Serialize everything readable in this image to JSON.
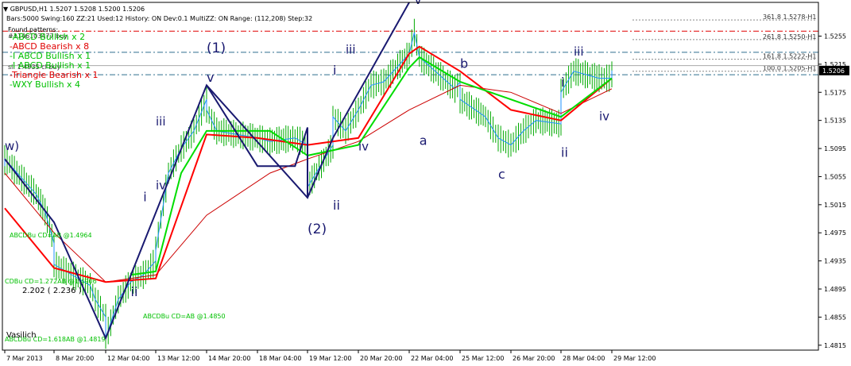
{
  "header": {
    "symbol_line": "GBPUSD,H1  1.5207 1.5208 1.5200 1.5206",
    "info_line": "Bars:5000  Swing:160  ZZ:21  Used:12  History: ON Dev:0.1  MultiZZ: ON  Range: (112,208)  Step:32",
    "found_patterns": "Found patterns:",
    "overlay_1": "#1146103477 buy",
    "overlay_2": "sl: 1.4935 cl buy"
  },
  "patterns": [
    {
      "label": "-ABCD Bullish x 2",
      "color": "#00c000"
    },
    {
      "label": "-ABCD Bearish x 8",
      "color": "#e00000"
    },
    {
      "label": "-I ABCD Bullish x 1",
      "color": "#00c000"
    },
    {
      "label": "-I ABCD Bullish x 1",
      "color": "#00c000"
    },
    {
      "label": "-Triangle Bearish x 1",
      "color": "#e00000"
    },
    {
      "label": "-WXY Bullish x 4",
      "color": "#00c000"
    }
  ],
  "annotations": {
    "abcd_1": "ABCDBu CD=AB   @1.4964",
    "abcd_2": "CDBu CD=1.272AB   @1.4906",
    "abcd_3": "ABCDBu CD=AB   @1.4850",
    "abcd_4": "ABCDBu CD=1.618AB   @1.4819",
    "ratio": "2.202 ( 2.236 )",
    "vasilich": "Vasilich"
  },
  "fib_levels": [
    {
      "label": "361.8 1.5278-H1",
      "price": 1.5278
    },
    {
      "label": "261.8 1.5250-H1",
      "price": 1.525
    },
    {
      "label": "161.8 1.5222-H1",
      "price": 1.5222
    },
    {
      "label": "100.0 1.5205-H1",
      "price": 1.5205
    }
  ],
  "waves": [
    {
      "label": "w)",
      "x": "7 Mar 2013",
      "y": 1.5093,
      "size": 15
    },
    {
      "label": "(1)",
      "x": "14 Mar 20:00",
      "y": 1.5232,
      "size": 17
    },
    {
      "label": "v",
      "x": "14 Mar 20:00",
      "y": 1.519,
      "size": 16
    },
    {
      "label": "iii",
      "x": "13 Mar 12:00",
      "y": 1.5128,
      "size": 15
    },
    {
      "label": "iv",
      "x": "13 Mar 12:00",
      "y": 1.5037,
      "size": 15
    },
    {
      "label": "i",
      "x": "13 Mar 04:00",
      "y": 1.502,
      "size": 16
    },
    {
      "label": "ii",
      "x": "12 Mar 20:00",
      "y": 1.4885,
      "size": 16
    },
    {
      "label": "i",
      "x": "20 Mar 04:00",
      "y": 1.52,
      "size": 16
    },
    {
      "label": "iii",
      "x": "20 Mar 12:00",
      "y": 1.523,
      "size": 15
    },
    {
      "label": "iv",
      "x": "20 Mar 20:00",
      "y": 1.5092,
      "size": 15
    },
    {
      "label": "ii",
      "x": "20 Mar 04:00",
      "y": 1.5008,
      "size": 16
    },
    {
      "label": "(2)",
      "x": "19 Mar 12:00",
      "y": 1.4974,
      "size": 17
    },
    {
      "label": "v",
      "x": "22 Mar 12:00",
      "y": 1.5301,
      "size": 16
    },
    {
      "label": "a",
      "x": "22 Mar 20:00",
      "y": 1.51,
      "size": 16
    },
    {
      "label": "b",
      "x": "25 Mar 12:00",
      "y": 1.521,
      "size": 16
    },
    {
      "label": "c",
      "x": "26 Mar 12:00",
      "y": 1.5052,
      "size": 16
    },
    {
      "label": "i",
      "x": "28 Mar 04:00",
      "y": 1.5183,
      "size": 16
    },
    {
      "label": "ii",
      "x": "28 Mar 04:00",
      "y": 1.5083,
      "size": 16
    },
    {
      "label": "iii",
      "x": "28 Mar 12:00",
      "y": 1.5227,
      "size": 15
    },
    {
      "label": "iv",
      "x": "29 Mar 04:00",
      "y": 1.5135,
      "size": 15
    }
  ],
  "colors": {
    "background": "#ffffff",
    "bars": "#00aa00",
    "ma_fast": "#ff0000",
    "ma_slow_line": "#cc0000",
    "ma_green": "#00dd00",
    "zigzag_navy": "#191970",
    "zigzag_blue": "#1e90ff",
    "wave_text": "#191970",
    "price_box": "#000000"
  },
  "chart_data": {
    "type": "line",
    "title": "GBPUSD,H1",
    "x_labels": [
      "7 Mar 2013",
      "8 Mar 20:00",
      "12 Mar 04:00",
      "13 Mar 12:00",
      "14 Mar 20:00",
      "18 Mar 04:00",
      "19 Mar 12:00",
      "20 Mar 20:00",
      "22 Mar 04:00",
      "25 Mar 12:00",
      "26 Mar 20:00",
      "28 Mar 04:00",
      "29 Mar 12:00"
    ],
    "y_ticks": [
      "1.5255",
      "1.5215",
      "1.5175",
      "1.5135",
      "1.5095",
      "1.5055",
      "1.5015",
      "1.4975",
      "1.4935",
      "1.4895",
      "1.4855",
      "1.4815"
    ],
    "ylim": [
      1.4808,
      1.5303
    ],
    "last_price": "1.5206",
    "series": [
      {
        "type": "ohlc_path",
        "points": [
          [
            "7 Mar 2013",
            1.507
          ],
          [
            "7 Mar 2013",
            1.508
          ],
          [
            "8 Mar 04:00",
            1.503
          ],
          [
            "8 Mar 12:00",
            1.5005
          ],
          [
            "8 Mar 20:00",
            1.496
          ],
          [
            "8 Mar 20:00",
            1.493
          ],
          [
            "11 Mar 04:00",
            1.49
          ],
          [
            "11 Mar 12:00",
            1.488
          ],
          [
            "12 Mar 04:00",
            1.4855
          ],
          [
            "12 Mar 04:00",
            1.4825
          ],
          [
            "12 Mar 12:00",
            1.488
          ],
          [
            "12 Mar 20:00",
            1.4905
          ],
          [
            "13 Mar 04:00",
            1.4915
          ],
          [
            "13 Mar 12:00",
            1.4935
          ],
          [
            "13 Mar 12:00",
            1.495
          ],
          [
            "13 Mar 20:00",
            1.506
          ],
          [
            "14 Mar 04:00",
            1.5095
          ],
          [
            "14 Mar 12:00",
            1.512
          ],
          [
            "14 Mar 20:00",
            1.5165
          ],
          [
            "14 Mar 20:00",
            1.515
          ],
          [
            "15 Mar 04:00",
            1.5135
          ],
          [
            "15 Mar 12:00",
            1.512
          ],
          [
            "18 Mar 04:00",
            1.511
          ],
          [
            "18 Mar 12:00",
            1.5105
          ],
          [
            "19 Mar 04:00",
            1.511
          ],
          [
            "19 Mar 12:00",
            1.51
          ],
          [
            "19 Mar 12:00",
            1.504
          ],
          [
            "20 Mar 04:00",
            1.51
          ],
          [
            "20 Mar 04:00",
            1.514
          ],
          [
            "20 Mar 12:00",
            1.512
          ],
          [
            "20 Mar 20:00",
            1.515
          ],
          [
            "21 Mar 04:00",
            1.5185
          ],
          [
            "21 Mar 12:00",
            1.519
          ],
          [
            "22 Mar 04:00",
            1.523
          ],
          [
            "22 Mar 12:00",
            1.526
          ],
          [
            "22 Mar 20:00",
            1.5225
          ],
          [
            "25 Mar 04:00",
            1.518
          ],
          [
            "25 Mar 12:00",
            1.519
          ],
          [
            "25 Mar 12:00",
            1.5165
          ],
          [
            "26 Mar 04:00",
            1.514
          ],
          [
            "26 Mar 12:00",
            1.511
          ],
          [
            "26 Mar 20:00",
            1.51
          ],
          [
            "27 Mar 04:00",
            1.512
          ],
          [
            "27 Mar 12:00",
            1.5135
          ],
          [
            "28 Mar 04:00",
            1.513
          ],
          [
            "28 Mar 04:00",
            1.5175
          ],
          [
            "28 Mar 12:00",
            1.5205
          ],
          [
            "29 Mar 04:00",
            1.5195
          ],
          [
            "29 Mar 12:00",
            1.5195
          ],
          [
            "29 Mar 12:00",
            1.5206
          ]
        ]
      },
      {
        "type": "ma_red",
        "points": [
          [
            "7 Mar 2013",
            1.501
          ],
          [
            "8 Mar 20:00",
            1.4925
          ],
          [
            "12 Mar 04:00",
            1.4905
          ],
          [
            "13 Mar 12:00",
            1.491
          ],
          [
            "14 Mar 20:00",
            1.5115
          ],
          [
            "18 Mar 04:00",
            1.511
          ],
          [
            "19 Mar 12:00",
            1.51
          ],
          [
            "20 Mar 20:00",
            1.511
          ],
          [
            "22 Mar 04:00",
            1.523
          ],
          [
            "22 Mar 20:00",
            1.524
          ],
          [
            "25 Mar 12:00",
            1.5205
          ],
          [
            "26 Mar 20:00",
            1.515
          ],
          [
            "28 Mar 04:00",
            1.5135
          ],
          [
            "29 Mar 12:00",
            1.5195
          ]
        ]
      },
      {
        "type": "ma_green",
        "points": [
          [
            "12 Mar 20:00",
            1.4915
          ],
          [
            "13 Mar 12:00",
            1.492
          ],
          [
            "14 Mar 04:00",
            1.506
          ],
          [
            "14 Mar 20:00",
            1.512
          ],
          [
            "18 Mar 12:00",
            1.512
          ],
          [
            "19 Mar 12:00",
            1.5085
          ],
          [
            "20 Mar 20:00",
            1.51
          ],
          [
            "22 Mar 04:00",
            1.521
          ],
          [
            "22 Mar 20:00",
            1.5225
          ],
          [
            "25 Mar 12:00",
            1.519
          ],
          [
            "28 Mar 04:00",
            1.514
          ],
          [
            "29 Mar 12:00",
            1.5195
          ]
        ]
      },
      {
        "type": "ma_slow",
        "points": [
          [
            "7 Mar 2013",
            1.506
          ],
          [
            "8 Mar 20:00",
            1.4975
          ],
          [
            "12 Mar 04:00",
            1.4905
          ],
          [
            "13 Mar 12:00",
            1.4915
          ],
          [
            "14 Mar 20:00",
            1.5
          ],
          [
            "18 Mar 12:00",
            1.506
          ],
          [
            "19 Mar 12:00",
            1.508
          ],
          [
            "20 Mar 20:00",
            1.5105
          ],
          [
            "22 Mar 04:00",
            1.515
          ],
          [
            "25 Mar 12:00",
            1.5185
          ],
          [
            "26 Mar 20:00",
            1.5175
          ],
          [
            "28 Mar 04:00",
            1.5145
          ],
          [
            "29 Mar 12:00",
            1.518
          ]
        ]
      }
    ],
    "zigzag_navy": [
      [
        "7 Mar 2013",
        1.508
      ],
      [
        "8 Mar 20:00",
        1.499
      ],
      [
        "12 Mar 04:00",
        1.4825
      ],
      [
        "14 Mar 20:00",
        1.5185
      ],
      [
        "19 Mar 12:00",
        1.5025
      ],
      [
        "20 Mar 04:00",
        1.511
      ],
      [
        "22 Mar 04:00",
        1.5303
      ]
    ],
    "triangle": [
      [
        "14 Mar 20:00",
        1.5185
      ],
      [
        "18 Mar 04:00",
        1.507
      ],
      [
        "19 Mar 04:00",
        1.507
      ],
      [
        "19 Mar 12:00",
        1.5125
      ],
      [
        "19 Mar 12:00",
        1.5025
      ]
    ]
  }
}
